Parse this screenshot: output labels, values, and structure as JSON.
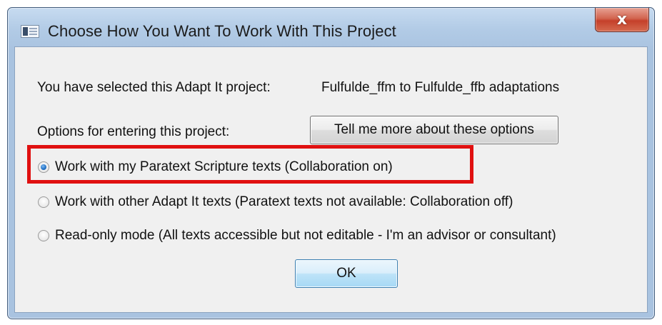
{
  "window": {
    "title": "Choose How You Want To Work With This Project",
    "close_label": "x"
  },
  "project": {
    "label": "You have selected this Adapt It project:",
    "name": "Fulfulde_ffm to Fulfulde_ffb adaptations"
  },
  "options": {
    "label": "Options for entering this project:",
    "more_button": "Tell me more about these options",
    "choices": [
      {
        "label": "Work with my Paratext Scripture texts (Collaboration on)",
        "selected": true
      },
      {
        "label": "Work with other Adapt It texts (Paratext texts not available: Collaboration off)",
        "selected": false
      },
      {
        "label": "Read-only mode (All texts accessible but not editable - I'm an advisor or consultant)",
        "selected": false
      }
    ]
  },
  "buttons": {
    "ok": "OK"
  },
  "colors": {
    "highlight": "#e01010",
    "titlebar": "#b2cbe6",
    "close_button": "#c5402a"
  }
}
